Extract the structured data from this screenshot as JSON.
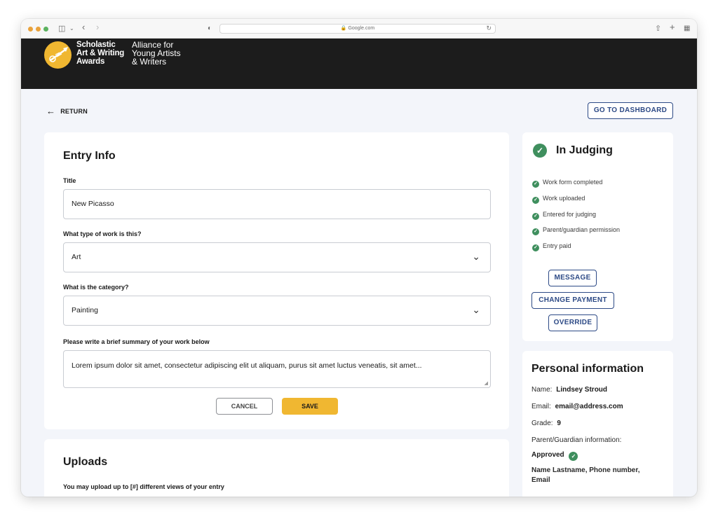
{
  "browser": {
    "url": "Google.com"
  },
  "site": {
    "logo_main_lines": [
      "Scholastic",
      "Art & Writing",
      "Awards"
    ],
    "logo_sub_lines": [
      "Alliance for",
      "Young Artists",
      "& Writers"
    ]
  },
  "nav": {
    "return_label": "RETURN",
    "dashboard_label": "GO TO DASHBOARD"
  },
  "entry_info": {
    "heading": "Entry Info",
    "title_label": "Title",
    "title_value": "New Picasso",
    "type_label": "What type of work is this?",
    "type_value": "Art",
    "category_label": "What is the category?",
    "category_value": "Painting",
    "summary_label": "Please write a brief summary of your work below",
    "summary_value": "Lorem ipsum dolor sit amet, consectetur adipiscing elit ut aliquam, purus sit amet luctus veneatis,  sit amet...",
    "cancel_label": "CANCEL",
    "save_label": "SAVE"
  },
  "uploads": {
    "heading": "Uploads",
    "note": "You may upload up to [#] different views of your entry"
  },
  "status": {
    "heading": "In Judging",
    "steps": [
      "Work form completed",
      "Work uploaded",
      "Entered for judging",
      "Parent/guardian permission",
      "Entry paid"
    ],
    "message_label": "MESSAGE",
    "change_payment_label": "CHANGE PAYMENT",
    "override_label": "OVERRIDE"
  },
  "personal": {
    "heading": "Personal information",
    "name_label": "Name:",
    "name_value": "Lindsey Stroud",
    "email_label": "Email:",
    "email_value": "email@address.com",
    "grade_label": "Grade:",
    "grade_value": "9",
    "guardian_label": "Parent/Guardian information:",
    "guardian_status": "Approved",
    "guardian_contact_line1": "Name Lastname,  Phone number,",
    "guardian_contact_line2": "Email"
  },
  "colors": {
    "accent_yellow": "#f0b731",
    "primary_blue": "#2d4a86",
    "success_green": "#3f8f5e",
    "header_dark": "#1c1c1c"
  }
}
